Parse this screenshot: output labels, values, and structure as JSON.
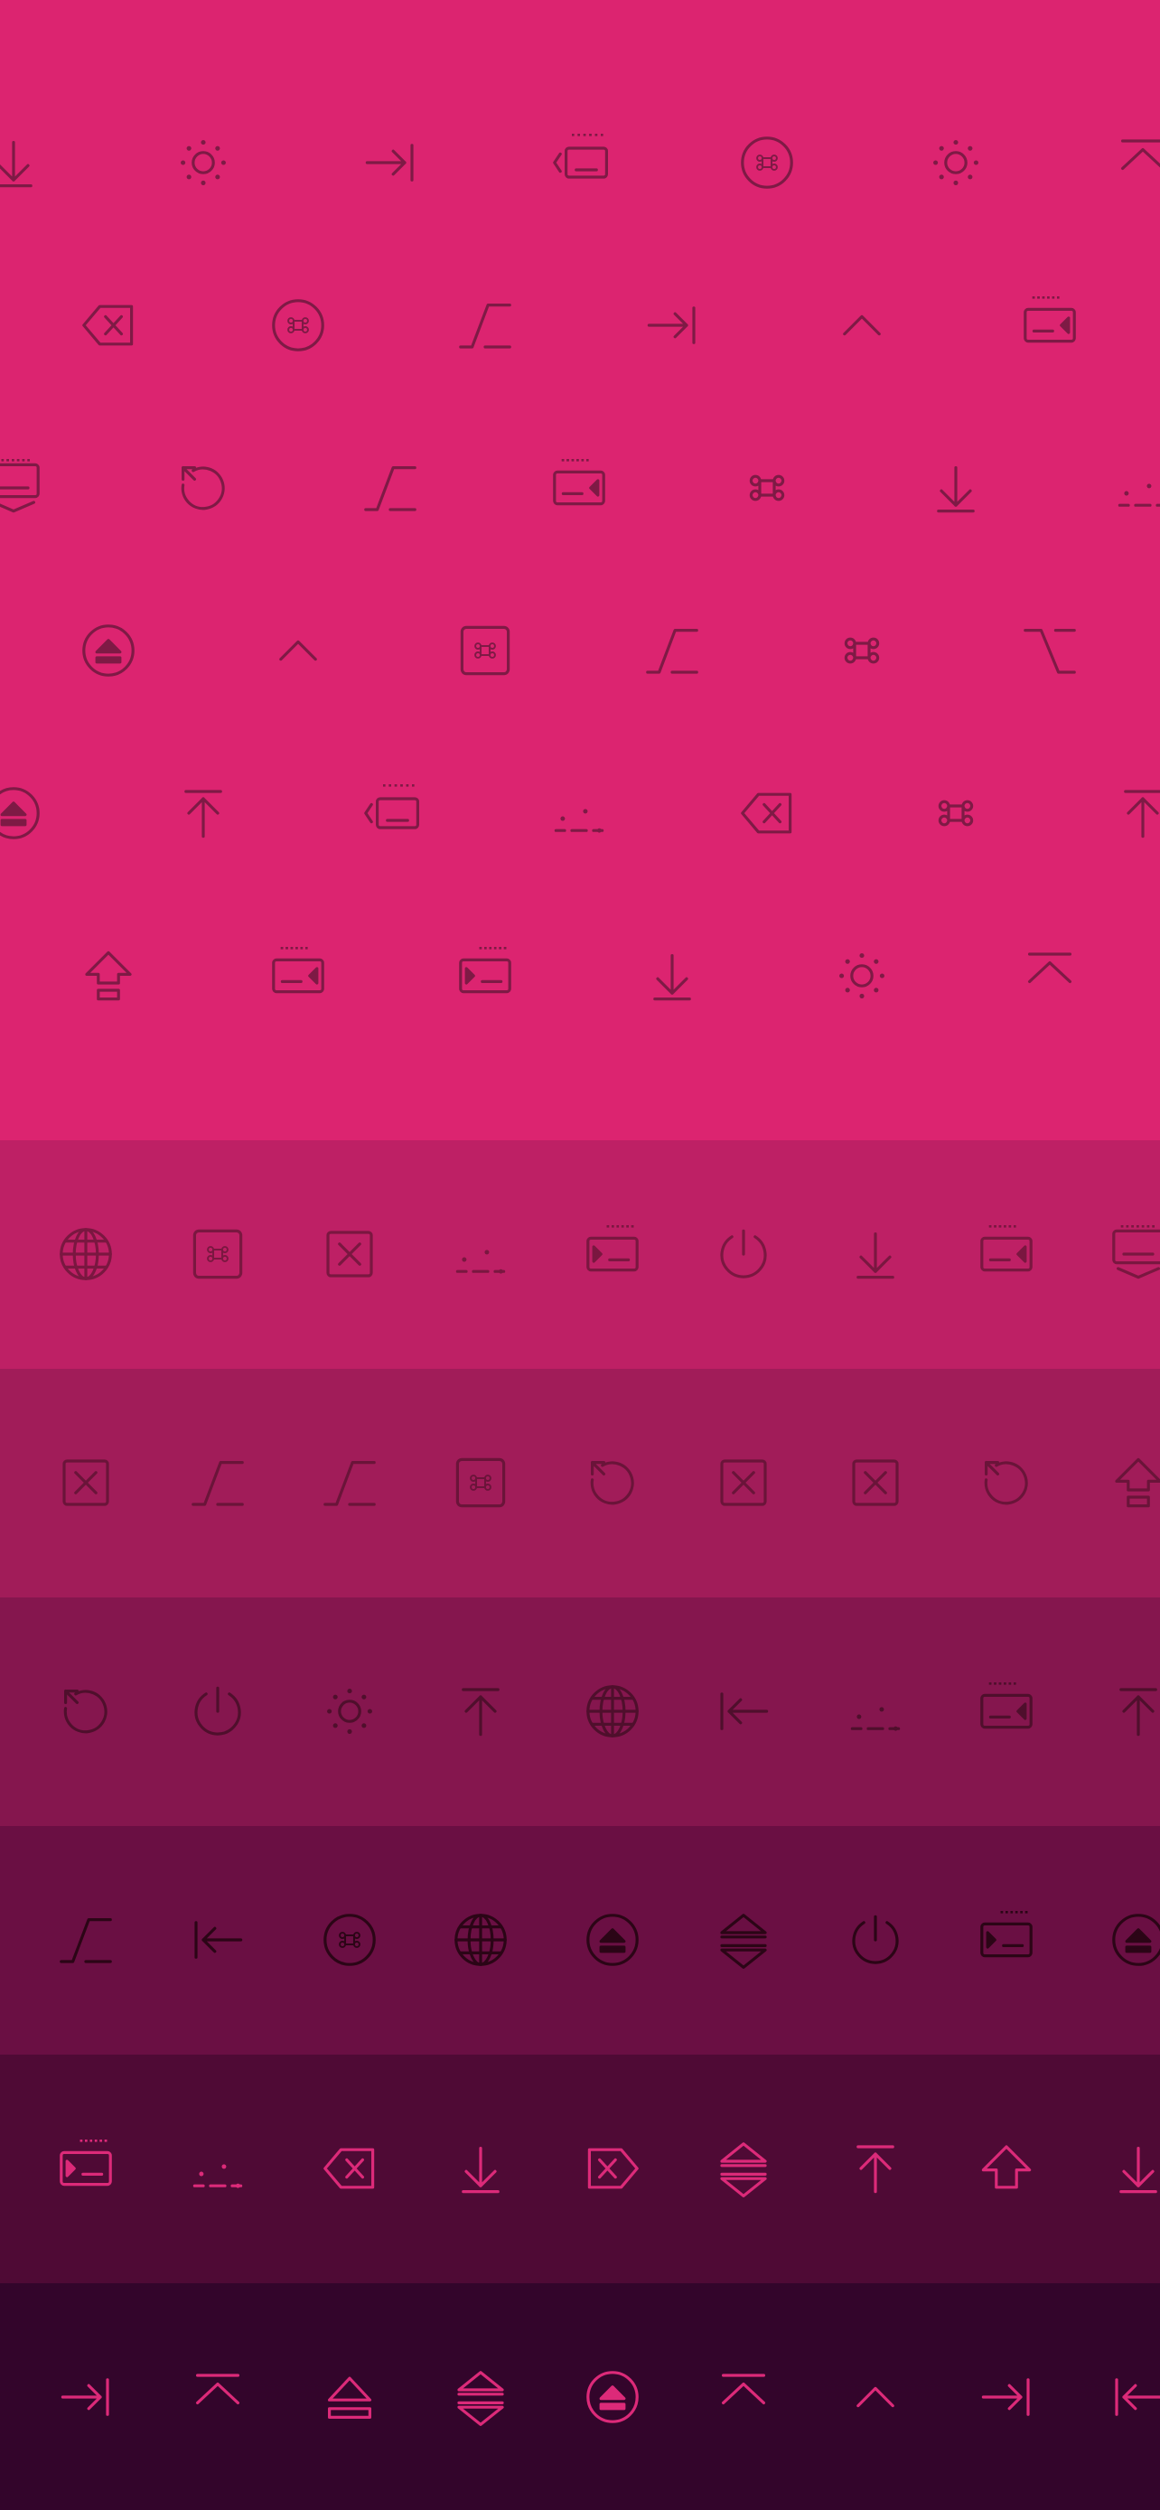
{
  "palette": {
    "top_background": "#dc2470",
    "top_icon_color": "#7e1a45"
  },
  "top_section": {
    "rows": [
      [
        "download-icon",
        "brightness-icon",
        "tab-right-icon",
        "keyboard-backlight-left-icon",
        "command-circle-icon",
        "brightness-icon",
        "eject-bar-icon"
      ],
      [
        "delete-icon",
        "command-circle-icon",
        "function-icon",
        "tab-right-icon",
        "control-caret-icon",
        "keyboard-left-icon"
      ],
      [
        "keyboard-hide-icon",
        "refresh-icon",
        "function-icon",
        "keyboard-left-icon",
        "command-icon",
        "download-icon",
        "brightness-low-icon"
      ],
      [
        "eject-circle-icon",
        "control-caret-icon",
        "command-square-icon",
        "function-icon",
        "command-icon",
        "option-icon"
      ],
      [
        "eject-circle-icon",
        "upload-icon",
        "keyboard-backlight-left-icon",
        "brightness-low-icon",
        "delete-icon",
        "command-icon",
        "upload-icon"
      ],
      [
        "shift-lock-icon",
        "keyboard-left-icon",
        "keyboard-right-icon",
        "download-icon",
        "brightness-icon",
        "eject-bar-icon"
      ]
    ]
  },
  "bands": [
    {
      "background": "#be2065",
      "icon_color": "#7a1740",
      "icons": [
        "globe-icon",
        "command-square-icon",
        "close-square-icon",
        "brightness-low-icon",
        "keyboard-right-icon",
        "power-icon",
        "download-icon",
        "keyboard-left-icon",
        "keyboard-hide-icon"
      ]
    },
    {
      "background": "#a11c59",
      "icon_color": "#6a1439",
      "icons": [
        "close-square-icon",
        "function-icon",
        "function-icon",
        "command-square-icon",
        "refresh-icon",
        "close-square-icon",
        "close-square-icon",
        "refresh-icon",
        "shift-lock-icon"
      ]
    },
    {
      "background": "#85164e",
      "icon_color": "#4f0f2c",
      "icons": [
        "refresh-icon",
        "power-icon",
        "brightness-icon",
        "upload-icon",
        "globe-icon",
        "tab-left-icon",
        "brightness-low-icon",
        "keyboard-left-icon",
        "upload-icon"
      ]
    },
    {
      "background": "#6a0f43",
      "icon_color": "#2b0516",
      "icons": [
        "function-icon",
        "tab-left-icon",
        "command-circle-icon",
        "globe-icon",
        "eject-circle-icon",
        "expand-collapse-icon",
        "power-icon",
        "keyboard-right-icon",
        "eject-circle-icon"
      ]
    },
    {
      "background": "#4f0a35",
      "icon_color": "#dc2a79",
      "icons": [
        "keyboard-right-icon",
        "brightness-low-icon",
        "delete-icon",
        "download-icon",
        "delete-right-icon",
        "expand-collapse-icon",
        "upload-icon",
        "shift-icon",
        "download-icon"
      ]
    },
    {
      "background": "#33052b",
      "icon_color": "#dc2a79",
      "icons": [
        "tab-right-icon",
        "eject-bar-icon",
        "eject-icon",
        "expand-collapse-icon",
        "eject-circle-icon",
        "eject-bar-icon",
        "control-caret-icon",
        "tab-right-icon",
        "tab-left-icon"
      ]
    }
  ]
}
